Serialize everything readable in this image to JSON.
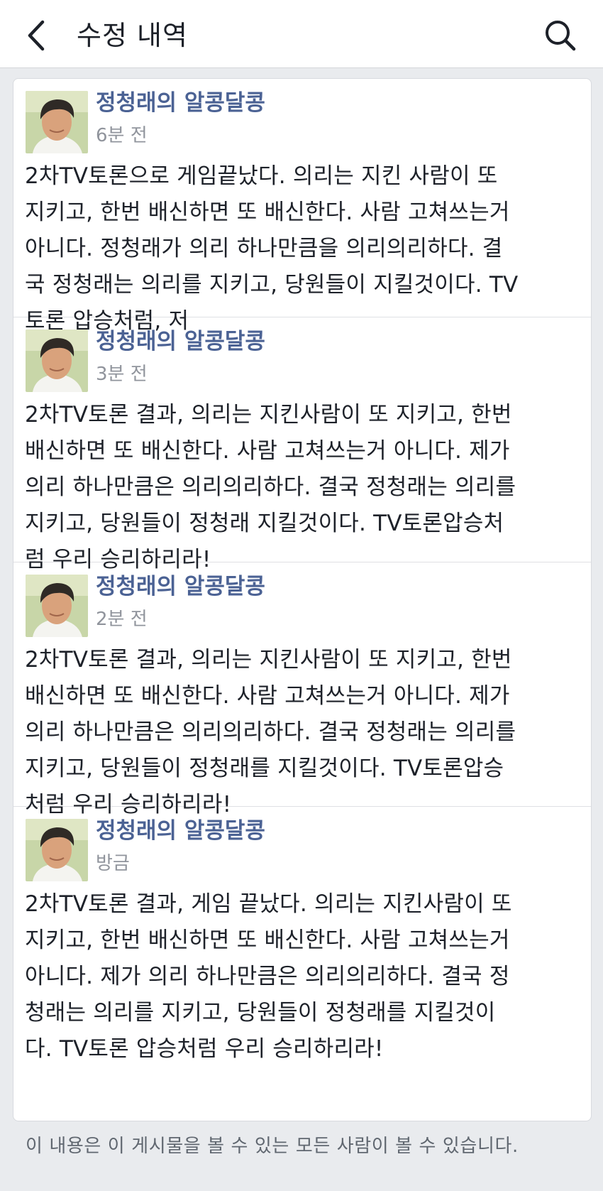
{
  "header": {
    "title": "수정 내역",
    "back_icon": "chevron-left-icon",
    "search_icon": "search-icon"
  },
  "entries": [
    {
      "author": "정청래의 알콩달콩",
      "time": "6분 전",
      "text": "2차TV토론으로 게임끝났다. 의리는 지킨 사람이 또\n지키고, 한번 배신하면 또 배신한다. 사람 고쳐쓰는거\n아니다. 정청래가 의리 하나만큼을 의리의리하다. 결\n국 정청래는 의리를 지키고, 당원들이 지킬것이다. TV\n토론 압승처럼, 저"
    },
    {
      "author": "정청래의 알콩달콩",
      "time": "3분 전",
      "text": "2차TV토론 결과, 의리는 지킨사람이 또 지키고, 한번\n배신하면 또 배신한다. 사람 고쳐쓰는거 아니다. 제가\n의리 하나만큼은 의리의리하다. 결국 정청래는 의리를\n지키고, 당원들이 정청래 지킬것이다. TV토론압승처\n럼 우리 승리하리라!"
    },
    {
      "author": "정청래의 알콩달콩",
      "time": "2분 전",
      "text": "2차TV토론 결과, 의리는 지킨사람이 또 지키고, 한번\n배신하면 또 배신한다. 사람 고쳐쓰는거 아니다. 제가\n의리 하나만큼은 의리의리하다. 결국 정청래는 의리를\n지키고, 당원들이 정청래를 지킬것이다. TV토론압승\n처럼 우리 승리하리라!"
    },
    {
      "author": "정청래의 알콩달콩",
      "time": "방금",
      "text": "2차TV토론 결과, 게임 끝났다. 의리는 지킨사람이 또\n지키고, 한번 배신하면 또 배신한다. 사람 고쳐쓰는거\n아니다. 제가 의리 하나만큼은 의리의리하다. 결국 정\n청래는 의리를 지키고, 당원들이 정청래를 지킬것이\n다. TV토론 압승처럼 우리 승리하리라!"
    }
  ],
  "footer": {
    "notice": "이 내용은 이 게시물을 볼 수 있는 모든 사람이 볼 수 있습니다."
  },
  "colors": {
    "author_link": "#4b6294",
    "background": "#e9ebee"
  }
}
